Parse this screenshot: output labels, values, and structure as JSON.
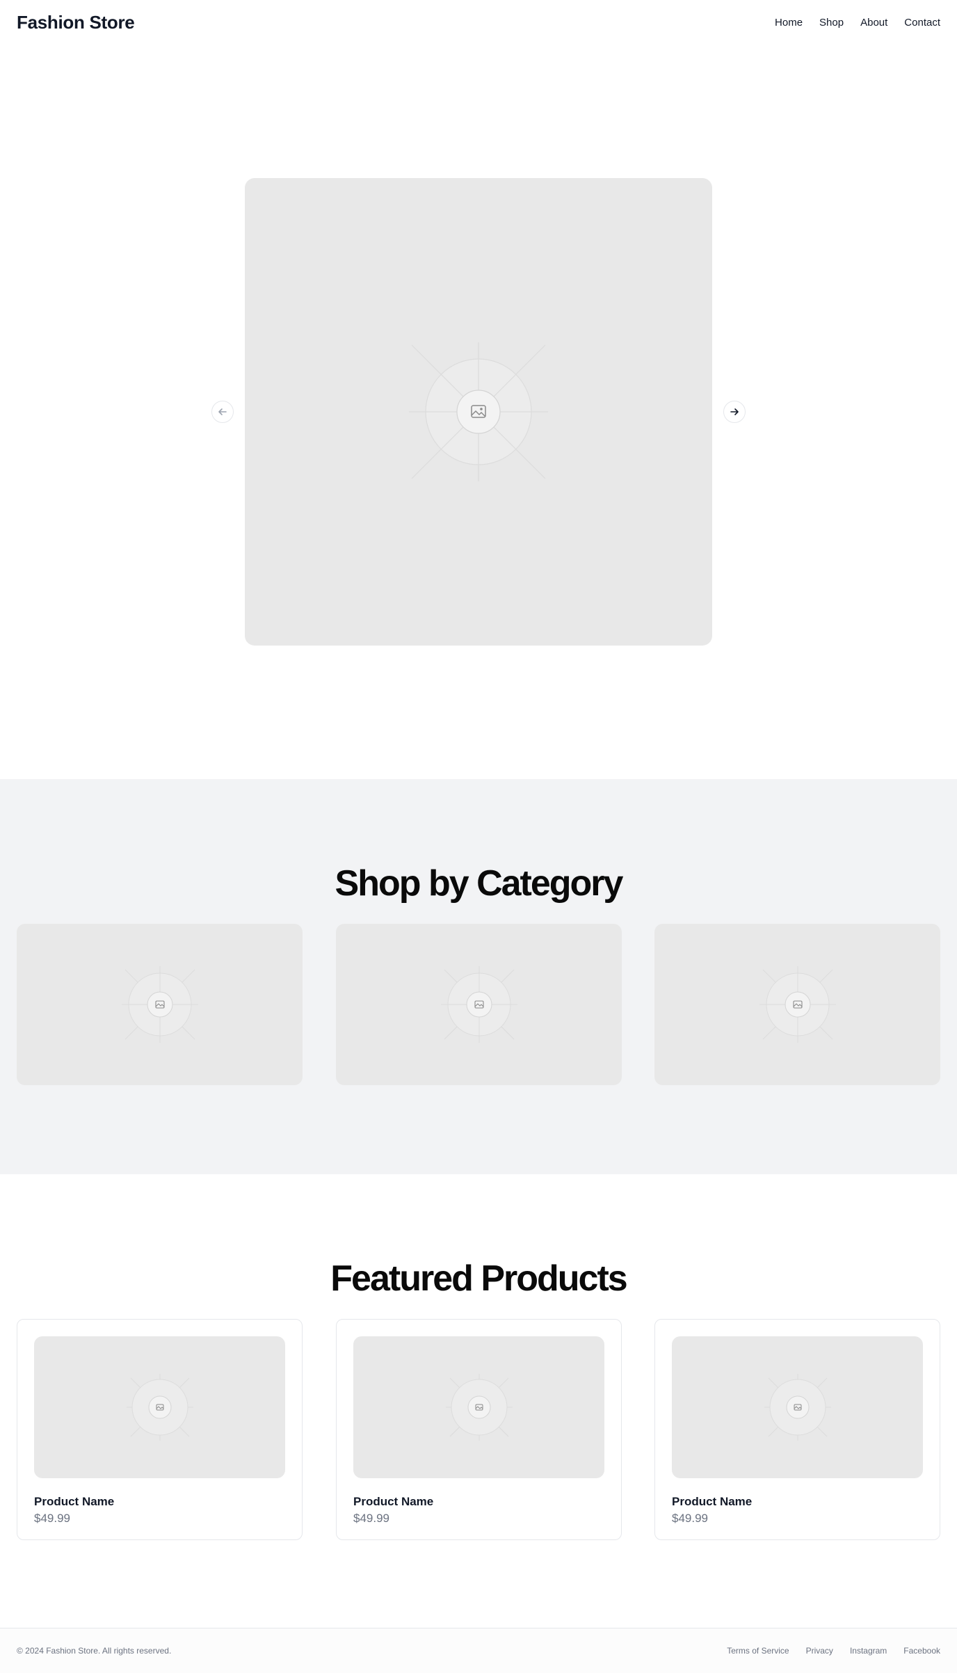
{
  "header": {
    "logo": "Fashion Store",
    "nav": [
      {
        "label": "Home"
      },
      {
        "label": "Shop"
      },
      {
        "label": "About"
      },
      {
        "label": "Contact"
      }
    ]
  },
  "hero": {
    "image_icon": "image-placeholder-icon",
    "prev_icon": "arrow-left-icon",
    "next_icon": "arrow-right-icon"
  },
  "category": {
    "title": "Shop by Category",
    "cards": [
      {
        "icon": "image-placeholder-icon"
      },
      {
        "icon": "image-placeholder-icon"
      },
      {
        "icon": "image-placeholder-icon"
      }
    ]
  },
  "featured": {
    "title": "Featured Products",
    "products": [
      {
        "name": "Product Name",
        "price": "$49.99"
      },
      {
        "name": "Product Name",
        "price": "$49.99"
      },
      {
        "name": "Product Name",
        "price": "$49.99"
      }
    ]
  },
  "footer": {
    "copyright": "© 2024 Fashion Store. All rights reserved.",
    "links": [
      {
        "label": "Terms of Service"
      },
      {
        "label": "Privacy"
      },
      {
        "label": "Instagram"
      },
      {
        "label": "Facebook"
      }
    ]
  },
  "colors": {
    "text": "#111827",
    "muted": "#6b7280",
    "placeholder_bg": "#e8e8e8",
    "section_bg": "#f2f3f5",
    "border": "#e5e7eb"
  }
}
